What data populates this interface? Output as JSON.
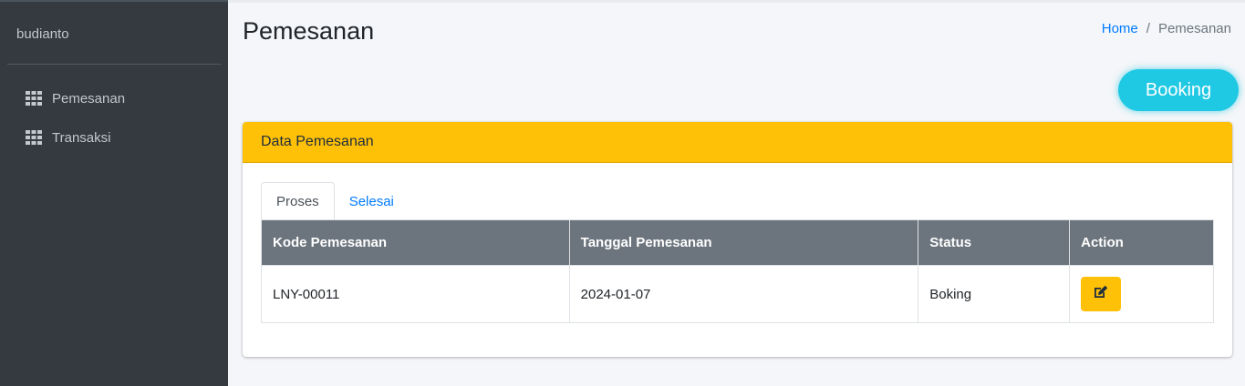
{
  "sidebar": {
    "user_name": "budianto",
    "items": [
      {
        "label": "Pemesanan",
        "icon": "grid-icon"
      },
      {
        "label": "Transaksi",
        "icon": "grid-icon"
      }
    ]
  },
  "header": {
    "title": "Pemesanan",
    "breadcrumb": [
      {
        "label": "Home"
      },
      {
        "label": "Pemesanan"
      }
    ],
    "separator": "/"
  },
  "booking_button": {
    "label": "Booking"
  },
  "card": {
    "title": "Data Pemesanan",
    "tabs": [
      {
        "label": "Proses",
        "active": true
      },
      {
        "label": "Selesai",
        "active": false
      }
    ],
    "table": {
      "columns": [
        "Kode Pemesanan",
        "Tanggal Pemesanan",
        "Status",
        "Action"
      ],
      "rows": [
        {
          "kode": "LNY-00011",
          "tanggal": "2024-01-07",
          "status": "Boking",
          "action_icon": "edit-icon"
        }
      ]
    }
  },
  "colors": {
    "sidebar_bg": "#343a40",
    "accent_yellow": "#ffc107",
    "booking_cyan": "#1fc8e3",
    "link_blue": "#007bff",
    "table_header": "#6c757d"
  }
}
